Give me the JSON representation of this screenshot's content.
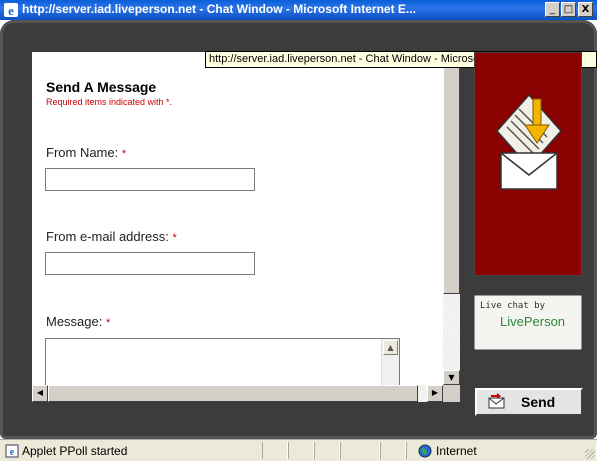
{
  "window": {
    "title": "http://server.iad.liveperson.net - Chat Window - Microsoft Internet E...",
    "controls": {
      "minimize": "_",
      "maximize": "□",
      "close": "X"
    }
  },
  "tooltip": {
    "text": "http://server.iad.liveperson.net - Chat Window - Microsoft Internet Explorer"
  },
  "form": {
    "title": "Send A Message",
    "required_note": "Required items indicated with *.",
    "required_marker": "*",
    "from_name": {
      "label": "From Name:",
      "value": ""
    },
    "from_email": {
      "label": "From e-mail address:",
      "value": ""
    },
    "message": {
      "label": "Message:",
      "value": ""
    }
  },
  "brand": {
    "live_chat_by": "Live chat by",
    "liveperson": "LivePerson",
    "panel_color": "#8b0000"
  },
  "send": {
    "label": "Send"
  },
  "statusbar": {
    "text": "Applet PPoll started",
    "zone": "Internet"
  },
  "icons": [
    "ie-icon",
    "envelope-icon",
    "send-icon",
    "globe-icon"
  ]
}
